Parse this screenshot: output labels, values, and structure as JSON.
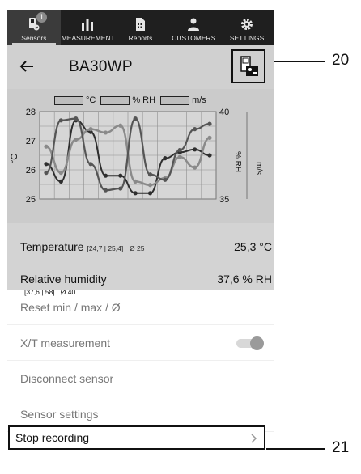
{
  "nav": {
    "items": [
      {
        "label": "Sensors",
        "icon": "sensor-device-icon",
        "badge": "1",
        "active": true
      },
      {
        "label": "MEASUREMENTS",
        "icon": "bar-chart-icon"
      },
      {
        "label": "Reports",
        "icon": "report-document-icon"
      },
      {
        "label": "CUSTOMERS",
        "icon": "person-icon"
      },
      {
        "label": "SETTINGS",
        "icon": "gear-icon"
      }
    ]
  },
  "header": {
    "title": "BA30WP",
    "back_icon": "back-arrow-icon",
    "device_icon": "device-info-icon"
  },
  "chart": {
    "legend": [
      "°C",
      "% RH",
      "m/s"
    ],
    "left_unit": "°C",
    "right_unit_rh": "% RH",
    "right_unit_ms": "m/s",
    "left_ticks": [
      "28",
      "27",
      "26",
      "25"
    ],
    "right_ticks": [
      "40",
      "35"
    ]
  },
  "chart_data": {
    "type": "line",
    "xlabel": "",
    "ylabel": "°C",
    "ylim": [
      25,
      28
    ],
    "y2label": "% RH",
    "y2lim": [
      35,
      40
    ],
    "grid": true,
    "series": [
      {
        "name": "°C",
        "axis": "left",
        "values": [
          26.2,
          25.6,
          27.7,
          27.3,
          25.8,
          25.8,
          25.2,
          25.2,
          26.4,
          26.6,
          26.7,
          26.5
        ]
      },
      {
        "name": "% RH",
        "axis": "right",
        "values": [
          38.0,
          36.5,
          38.4,
          39.0,
          38.8,
          39.2,
          36.0,
          35.8,
          36.2,
          37.4,
          36.8,
          38.5
        ]
      },
      {
        "name": "m/s",
        "axis": "right",
        "values": [
          36.5,
          39.5,
          39.6,
          37.0,
          35.5,
          35.6,
          39.6,
          36.4,
          36.1,
          37.8,
          39.0,
          39.3
        ]
      }
    ]
  },
  "values": {
    "temperature": {
      "label": "Temperature",
      "range": "[24,7 | 25,4]",
      "avg": "Ø 25",
      "value": "25,3 °C"
    },
    "humidity": {
      "label": "Relative humidity",
      "range": "[37,6 | 58]",
      "avg": "Ø 40",
      "value": "37,6 % RH"
    }
  },
  "menu": {
    "reset": "Reset min / max / Ø",
    "xt": "X/T measurement",
    "xt_toggle_on": true,
    "disconnect": "Disconnect sensor",
    "settings": "Sensor settings",
    "stop": "Stop recording"
  },
  "callouts": {
    "device": "20",
    "stop": "21"
  }
}
